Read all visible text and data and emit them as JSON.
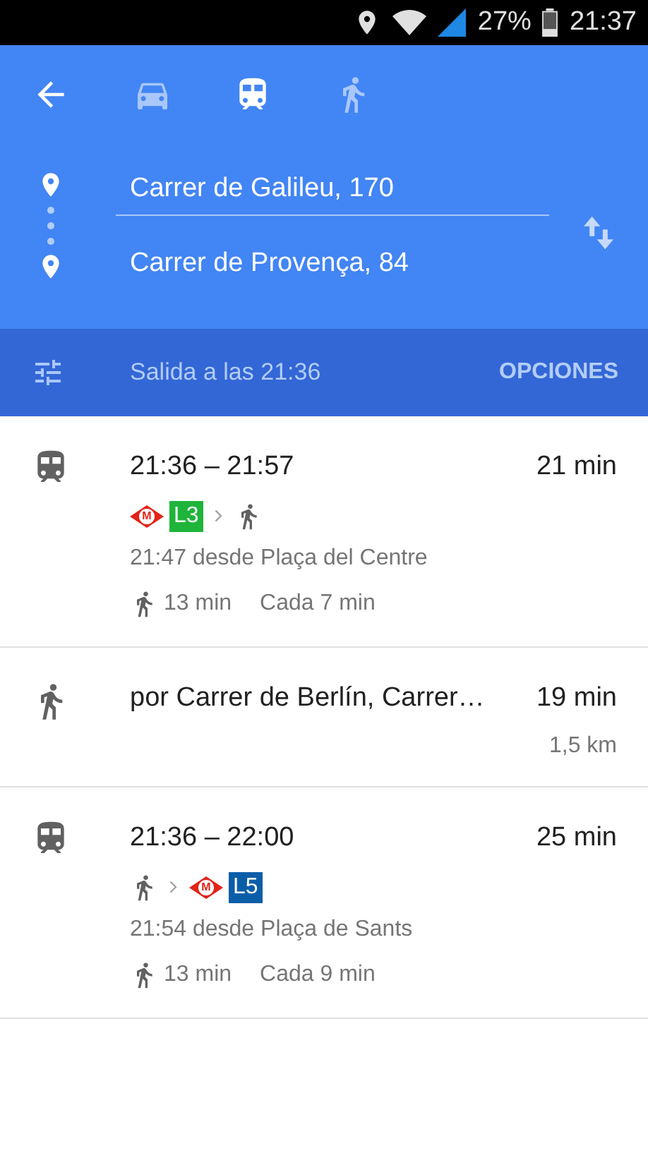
{
  "status_bar": {
    "battery": "27%",
    "time": "21:37"
  },
  "modes": [
    {
      "kind": "car",
      "selected": false
    },
    {
      "kind": "transit",
      "selected": true
    },
    {
      "kind": "walk",
      "selected": false
    }
  ],
  "origin": "Carrer de Galileu, 170",
  "destination": "Carrer de Provença, 84",
  "departure": "Salida a las 21:36",
  "options_button": "OPCIONES",
  "routes": [
    {
      "kind": "transit",
      "times": "21:36 – 21:57",
      "duration": "21 min",
      "segments": [
        {
          "kind": "metro",
          "logo": "M",
          "line": "L3",
          "color": "#1eb53a"
        },
        {
          "kind": "walk"
        }
      ],
      "departure_info": "21:47 desde Plaça del Centre",
      "walk_time": "13 min",
      "frequency": "Cada 7 min"
    },
    {
      "kind": "walk",
      "via": "por Carrer de Berlín, Carrer…",
      "duration": "19 min",
      "distance": "1,5 km"
    },
    {
      "kind": "transit",
      "times": "21:36 – 22:00",
      "duration": "25 min",
      "segments": [
        {
          "kind": "walk"
        },
        {
          "kind": "metro",
          "logo": "M",
          "line": "L5",
          "color": "#0a5ea8"
        }
      ],
      "departure_info": "21:54 desde Plaça de Sants",
      "walk_time": "13 min",
      "frequency": "Cada 9 min"
    }
  ]
}
